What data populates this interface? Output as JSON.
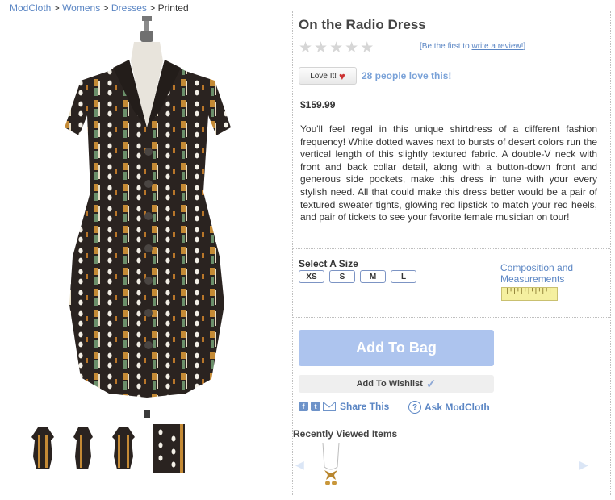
{
  "breadcrumb": {
    "items": [
      {
        "label": "ModCloth",
        "link": true
      },
      {
        "label": "Womens",
        "link": true
      },
      {
        "label": "Dresses",
        "link": true
      },
      {
        "label": "Printed",
        "link": false
      }
    ],
    "separator": ">"
  },
  "product": {
    "title": "On the Radio Dress",
    "rating": 0,
    "rating_max": 5,
    "review_prefix": "[Be the first to ",
    "review_link": "write a review!",
    "review_suffix": "]",
    "love_label": "Love It!",
    "love_count_text": "28 people love this!",
    "price": "$159.99",
    "description": "You'll feel regal in this unique shirtdress of a different fashion frequency! White dotted waves next to bursts of desert colors run the vertical length of this slightly textured fabric. A double-V neck with front and back collar detail, along with a button-down front and generous side pockets, make this dress in tune with your every stylish need. All that could make this dress better would be a pair of textured sweater tights, glowing red lipstick to match your red heels, and pair of tickets to see your favorite female musician on tour!"
  },
  "size": {
    "label": "Select A Size",
    "options": [
      "XS",
      "S",
      "M",
      "L"
    ],
    "composition_link": "Composition and Measurements"
  },
  "actions": {
    "add_to_bag": "Add To Bag",
    "add_to_wishlist": "Add To Wishlist",
    "share_label": "Share This",
    "ask_label": "Ask ModCloth"
  },
  "recent": {
    "title": "Recently Viewed Items"
  },
  "colors": {
    "link": "#5b86c4",
    "button_bag": "#adc4ee",
    "dress_dark": "#2a2320"
  },
  "icons": [
    "facebook-icon",
    "twitter-icon",
    "email-icon",
    "question-icon",
    "heart-icon",
    "checkmark-icon",
    "ruler-icon",
    "left-arrow-icon",
    "right-arrow-icon"
  ]
}
